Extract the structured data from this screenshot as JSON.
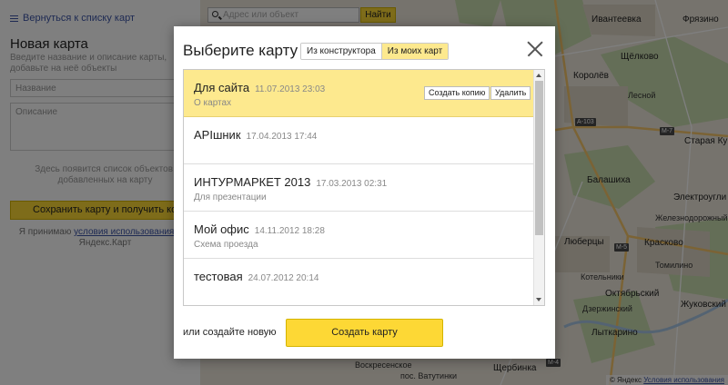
{
  "left_panel": {
    "back_link": "Вернуться к списку карт",
    "title": "Новая карта",
    "hint": "Введите название и описание карты, добавьте на неё объекты",
    "name_placeholder": "Название",
    "desc_placeholder": "Описание",
    "objects_hint": "Здесь появится список объектов, добавленных на карту",
    "save_button": "Сохранить карту и получить код",
    "terms_prefix": "Я принимаю",
    "terms_link": "условия использования",
    "terms_suffix": "API Яндекс.Карт"
  },
  "map": {
    "search_placeholder": "Адрес или объект",
    "search_button": "Найти",
    "labels": {
      "ivanteevka": "Ивантеевка",
      "fryazino": "Фрязино",
      "schelkovo": "Щёлково",
      "korolev": "Королёв",
      "balashikha": "Балашиха",
      "staraya_kupavna": "Старая Ку",
      "elektrougli": "Электроугли",
      "lyubertsy": "Люберцы",
      "kraskovo": "Красково",
      "kotelniki": "Котельники",
      "oktyabrsky": "Октябрьский",
      "zhukovsky": "Жуковский",
      "tomilino": "Томилино",
      "lytkarino": "Лыткарино",
      "dzerzhinsky": "Дзержинский",
      "shcherbinka": "Щербинка",
      "vatutinki": "пос. Ватутинки",
      "voskresenskoe": "Воскресенское",
      "zheleznodorozhny": "Железнодорожный",
      "lesnoy": "Лесной"
    },
    "roads": {
      "m7": "М-7",
      "a103": "A-103",
      "m5": "М-5",
      "m4": "М-4"
    },
    "copyright_prefix": "© Яндекс",
    "copyright_link": "Условия использования"
  },
  "dialog": {
    "title": "Выберите карту",
    "toggle": [
      "Из конструктора",
      "Из моих карт"
    ],
    "items": [
      {
        "title": "Для сайта",
        "date": "11.07.2013 23:03",
        "desc": "О картах",
        "copy_button": "Создать копию",
        "delete_button": "Удалить"
      },
      {
        "title": "APIшник",
        "date": "17.04.2013 17:44",
        "desc": ""
      },
      {
        "title": "ИНТУРМАРКЕТ 2013",
        "date": "17.03.2013 02:31",
        "desc": "Для презентации"
      },
      {
        "title": "Мой офис",
        "date": "14.11.2012 18:28",
        "desc": "Схема проезда"
      },
      {
        "title": "тестовая",
        "date": "24.07.2012 20:14",
        "desc": ""
      }
    ],
    "create_hint": "или создайте новую",
    "create_button": "Создать карту"
  },
  "colors": {
    "accent_yellow": "#fdd835",
    "selected_row": "#fde98e",
    "link_blue": "#3c55a6",
    "overlay": "rgba(0,0,0,0.5)"
  }
}
